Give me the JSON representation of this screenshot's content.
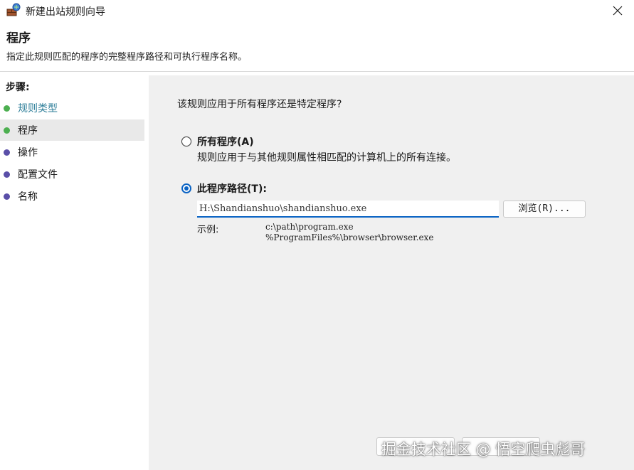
{
  "window": {
    "title": "新建出站规则向导"
  },
  "header": {
    "title": "程序",
    "description": "指定此规则匹配的程序的完整程序路径和可执行程序名称。"
  },
  "sidebar": {
    "steps_label": "步骤:",
    "items": [
      {
        "label": "规则类型",
        "color": "#3a8f3a",
        "dot": "#4caf50"
      },
      {
        "label": "程序",
        "color": "#1a1a1a",
        "dot": "#4caf50"
      },
      {
        "label": "操作",
        "color": "#1a1a1a",
        "dot": "#5a4fa8"
      },
      {
        "label": "配置文件",
        "color": "#1a1a1a",
        "dot": "#5a4fa8"
      },
      {
        "label": "名称",
        "color": "#1a1a1a",
        "dot": "#5a4fa8"
      }
    ]
  },
  "main": {
    "question": "该规则应用于所有程序还是特定程序?",
    "options": [
      {
        "label": "所有程序(A)",
        "description": "规则应用于与其他规则属性相匹配的计算机上的所有连接。",
        "checked": false
      },
      {
        "label": "此程序路径(T):",
        "checked": true
      }
    ],
    "path_value": "H:\\Shandianshuo\\shandianshuo.exe",
    "browse_label": "浏览(R)...",
    "example_label": "示例:",
    "example_lines": [
      "c:\\path\\program.exe",
      "%ProgramFiles%\\browser\\browser.exe"
    ]
  },
  "watermark": "掘金技术社区 @ 悟空爬虫彪哥",
  "colors": {
    "accent": "#0a63c4",
    "content_bg": "#f0f0f0"
  }
}
